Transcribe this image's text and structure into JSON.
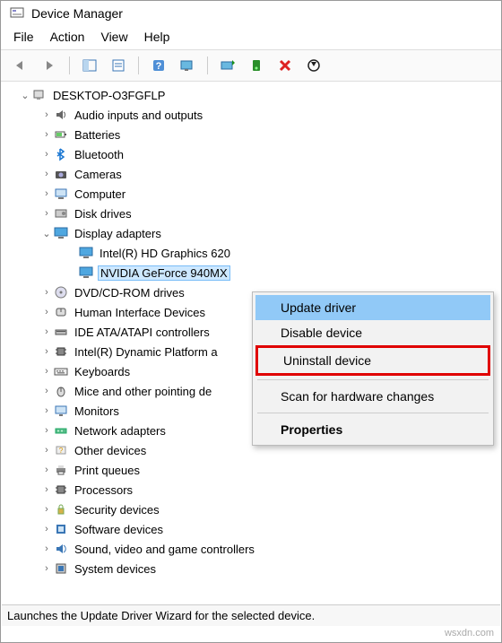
{
  "window": {
    "title": "Device Manager"
  },
  "menu": {
    "file": "File",
    "action": "Action",
    "view": "View",
    "help": "Help"
  },
  "tree": {
    "root": "DESKTOP-O3FGFLP",
    "nodes": [
      {
        "label": "Audio inputs and outputs",
        "expanded": false,
        "icon": "audio"
      },
      {
        "label": "Batteries",
        "expanded": false,
        "icon": "battery"
      },
      {
        "label": "Bluetooth",
        "expanded": false,
        "icon": "bluetooth"
      },
      {
        "label": "Cameras",
        "expanded": false,
        "icon": "camera"
      },
      {
        "label": "Computer",
        "expanded": false,
        "icon": "computer"
      },
      {
        "label": "Disk drives",
        "expanded": false,
        "icon": "disk"
      },
      {
        "label": "Display adapters",
        "expanded": true,
        "icon": "display",
        "children": [
          {
            "label": "Intel(R) HD Graphics 620",
            "icon": "display"
          },
          {
            "label": "NVIDIA GeForce 940MX",
            "icon": "display",
            "selected": true
          }
        ]
      },
      {
        "label": "DVD/CD-ROM drives",
        "expanded": false,
        "icon": "dvd"
      },
      {
        "label": "Human Interface Devices",
        "expanded": false,
        "icon": "hid"
      },
      {
        "label": "IDE ATA/ATAPI controllers",
        "expanded": false,
        "icon": "ide"
      },
      {
        "label": "Intel(R) Dynamic Platform and Thermal Framework",
        "expanded": false,
        "icon": "chip",
        "truncated": "Intel(R) Dynamic Platform a"
      },
      {
        "label": "Keyboards",
        "expanded": false,
        "icon": "keyboard"
      },
      {
        "label": "Mice and other pointing devices",
        "expanded": false,
        "icon": "mouse",
        "truncated": "Mice and other pointing de"
      },
      {
        "label": "Monitors",
        "expanded": false,
        "icon": "monitor"
      },
      {
        "label": "Network adapters",
        "expanded": false,
        "icon": "network"
      },
      {
        "label": "Other devices",
        "expanded": false,
        "icon": "other"
      },
      {
        "label": "Print queues",
        "expanded": false,
        "icon": "printer"
      },
      {
        "label": "Processors",
        "expanded": false,
        "icon": "chip"
      },
      {
        "label": "Security devices",
        "expanded": false,
        "icon": "security"
      },
      {
        "label": "Software devices",
        "expanded": false,
        "icon": "software"
      },
      {
        "label": "Sound, video and game controllers",
        "expanded": false,
        "icon": "sound"
      },
      {
        "label": "System devices",
        "expanded": false,
        "icon": "system",
        "truncated": "System devices"
      }
    ]
  },
  "context": {
    "update": "Update driver",
    "disable": "Disable device",
    "uninstall": "Uninstall device",
    "scan": "Scan for hardware changes",
    "properties": "Properties"
  },
  "status": "Launches the Update Driver Wizard for the selected device.",
  "watermark": "wsxdn.com"
}
